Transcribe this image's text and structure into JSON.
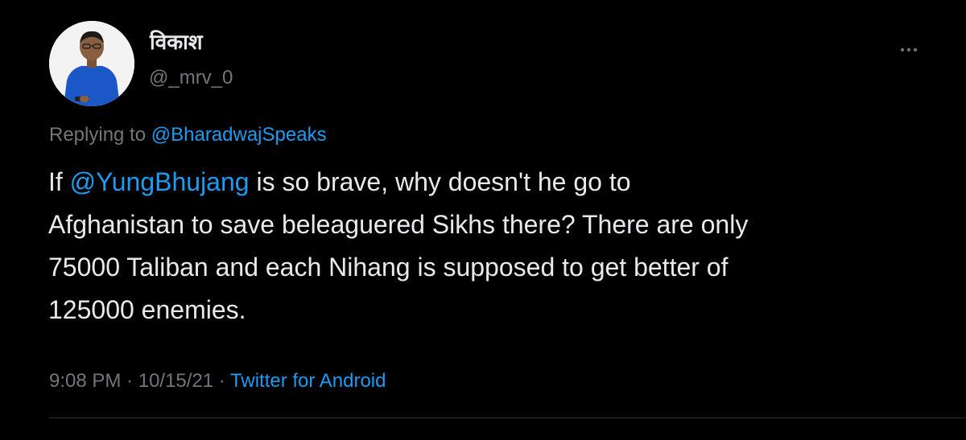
{
  "tweet": {
    "author": {
      "display_name": "विकाश",
      "handle": "@_mrv_0",
      "avatar": "profile-photo"
    },
    "more_icon": "more-horizontal-icon",
    "replying": {
      "label": "Replying to",
      "mention": "@BharadwajSpeaks"
    },
    "body": {
      "prefix": "If ",
      "mention": "@YungBhujang",
      "line1_rest": " is so brave, why doesn't he go to",
      "line2": "Afghanistan to save beleaguered Sikhs there? There are only",
      "line3": "75000 Taliban and each Nihang is supposed to get better of",
      "line4": "125000 enemies."
    },
    "meta": {
      "time": "9:08 PM",
      "separator": " · ",
      "date": "10/15/21",
      "source": "Twitter for Android"
    }
  },
  "colors": {
    "background": "#000000",
    "text": "#e7e9ea",
    "secondary": "#71767b",
    "link": "#1d9bf0",
    "divider": "#2f3336"
  }
}
